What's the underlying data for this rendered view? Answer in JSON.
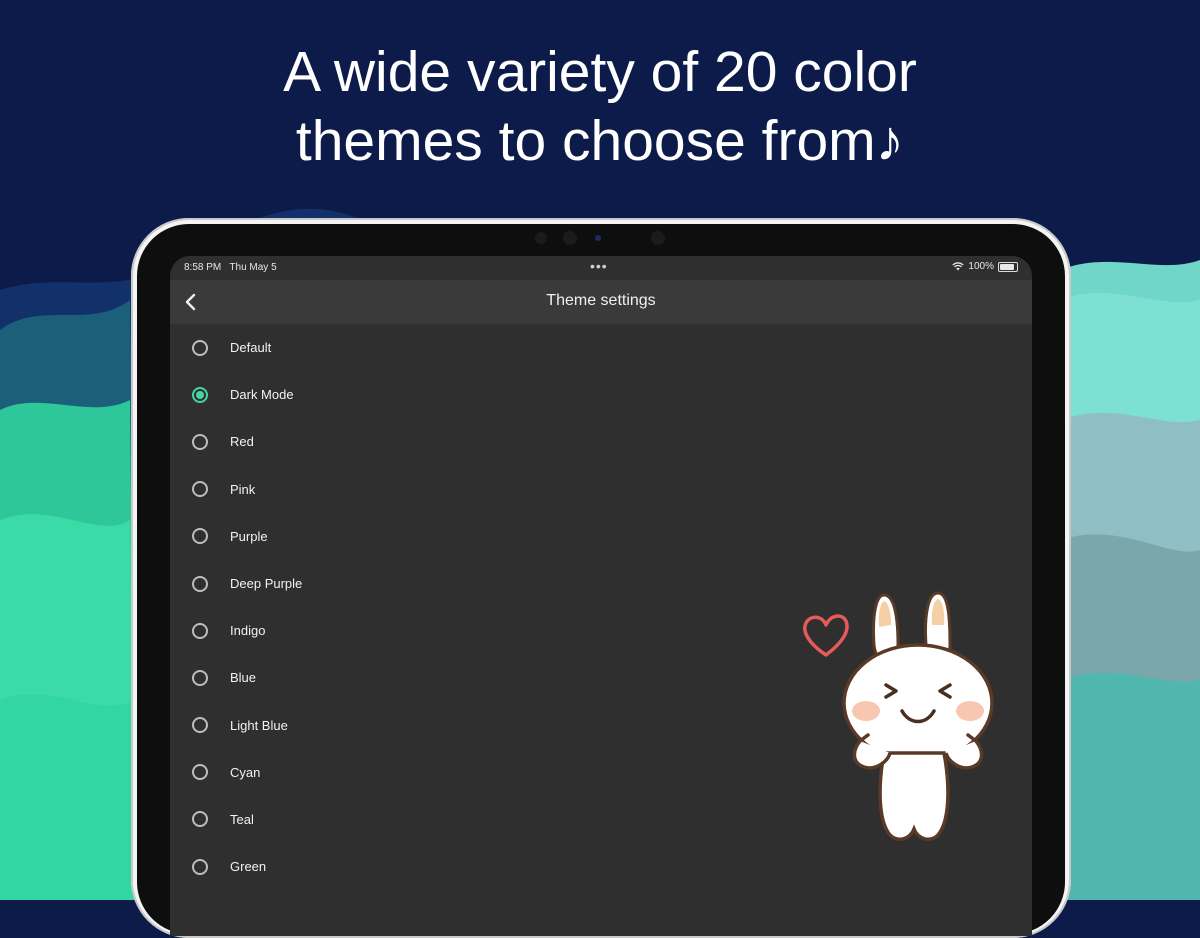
{
  "headline": {
    "line1": "A wide variety of 20 color",
    "line2": "themes to choose from♪"
  },
  "colors": {
    "background_navy": "#0d1b4a",
    "accent_green": "#46d3a6",
    "screen_bg": "#2f2f2f",
    "appbar_bg": "#3a3a3a"
  },
  "status_bar": {
    "time": "8:58 PM",
    "date": "Thu May 5",
    "multitask_dots": "•••",
    "battery_percent": "100%",
    "wifi_icon": "wifi-icon",
    "battery_icon": "battery-icon"
  },
  "appbar": {
    "back_icon": "chevron-left-icon",
    "title": "Theme settings"
  },
  "themes": [
    {
      "label": "Default",
      "selected": false
    },
    {
      "label": "Dark Mode",
      "selected": true
    },
    {
      "label": "Red",
      "selected": false
    },
    {
      "label": "Pink",
      "selected": false
    },
    {
      "label": "Purple",
      "selected": false
    },
    {
      "label": "Deep Purple",
      "selected": false
    },
    {
      "label": "Indigo",
      "selected": false
    },
    {
      "label": "Blue",
      "selected": false
    },
    {
      "label": "Light Blue",
      "selected": false
    },
    {
      "label": "Cyan",
      "selected": false
    },
    {
      "label": "Teal",
      "selected": false
    },
    {
      "label": "Green",
      "selected": false
    }
  ],
  "decor": {
    "mascot_icon": "bunny-mascot",
    "heart_icon": "heart-icon"
  }
}
